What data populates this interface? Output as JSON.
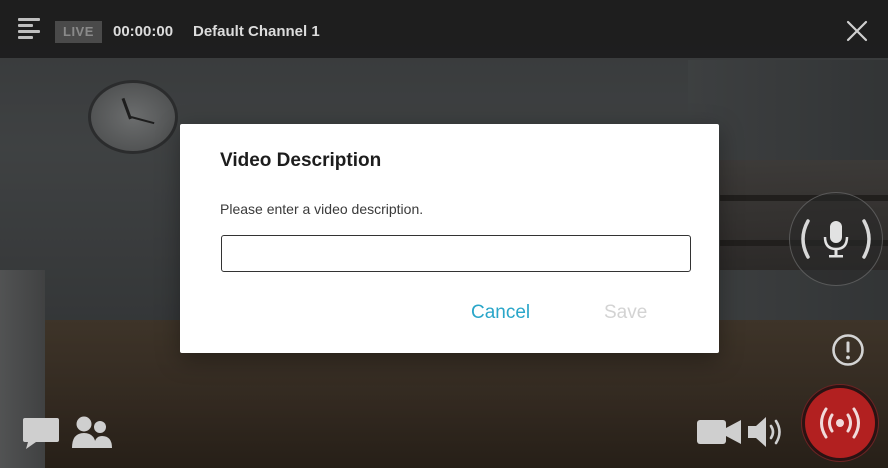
{
  "topbar": {
    "live_label": "LIVE",
    "timer": "00:00:00",
    "channel_name": "Default Channel 1"
  },
  "dialog": {
    "title": "Video Description",
    "message": "Please enter a video description.",
    "input_value": "",
    "cancel_label": "Cancel",
    "save_label": "Save"
  },
  "icons": {
    "menu": "menu-icon",
    "close": "close-icon",
    "mic": "microphone-icon",
    "alert": "alert-icon",
    "record": "broadcast-icon",
    "camera": "video-camera-icon",
    "speaker": "speaker-icon",
    "chat": "chat-icon",
    "users": "users-icon"
  },
  "colors": {
    "accent": "#2aa6c9",
    "record": "#b22020",
    "disabled": "#d3d3d3"
  }
}
